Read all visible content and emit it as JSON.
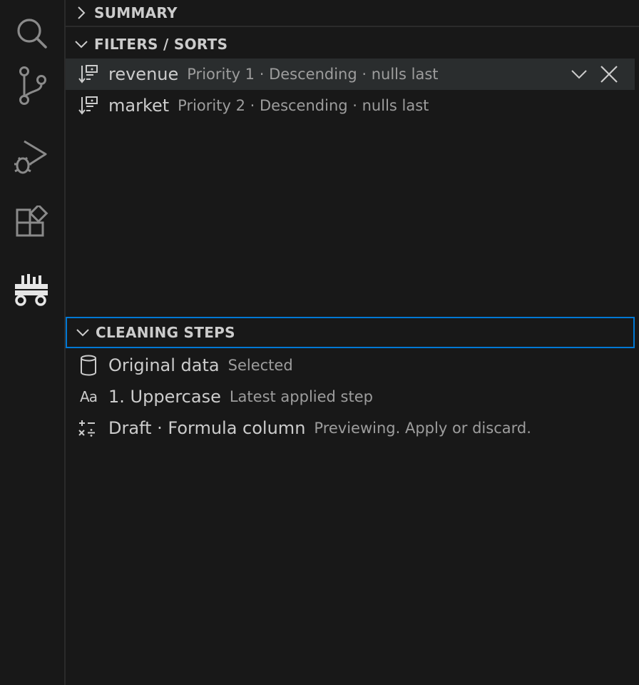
{
  "activity_bar": {
    "items": [
      {
        "name": "search",
        "icon": "search-icon"
      },
      {
        "name": "source-control",
        "icon": "source-control-icon"
      },
      {
        "name": "run-debug",
        "icon": "run-debug-icon"
      },
      {
        "name": "extensions",
        "icon": "extensions-icon"
      },
      {
        "name": "data-wrangler",
        "icon": "data-wrangler-icon"
      }
    ]
  },
  "sections": {
    "summary": {
      "title": "SUMMARY",
      "expanded": false
    },
    "filters_sorts": {
      "title": "FILTERS / SORTS",
      "expanded": true,
      "items": [
        {
          "label": "revenue",
          "description": "Priority 1 · Descending · nulls last",
          "icon": "sort-icon",
          "selected": true
        },
        {
          "label": "market",
          "description": "Priority 2 · Descending · nulls last",
          "icon": "sort-icon",
          "selected": false
        }
      ]
    },
    "cleaning_steps": {
      "title": "CLEANING STEPS",
      "expanded": true,
      "items": [
        {
          "label": "Original data",
          "description": "Selected",
          "icon": "database-icon"
        },
        {
          "label": "1. Uppercase",
          "description": "Latest applied step",
          "icon": "case-icon",
          "icon_text": "Aa"
        },
        {
          "label": "Draft · Formula column",
          "description": "Previewing. Apply or discard.",
          "icon": "formula-icon"
        }
      ]
    }
  },
  "colors": {
    "background": "#181818",
    "selected_row": "#2a2d2e",
    "focus_border": "#0078d4",
    "foreground": "#cccccc",
    "description": "#9d9d9d"
  }
}
